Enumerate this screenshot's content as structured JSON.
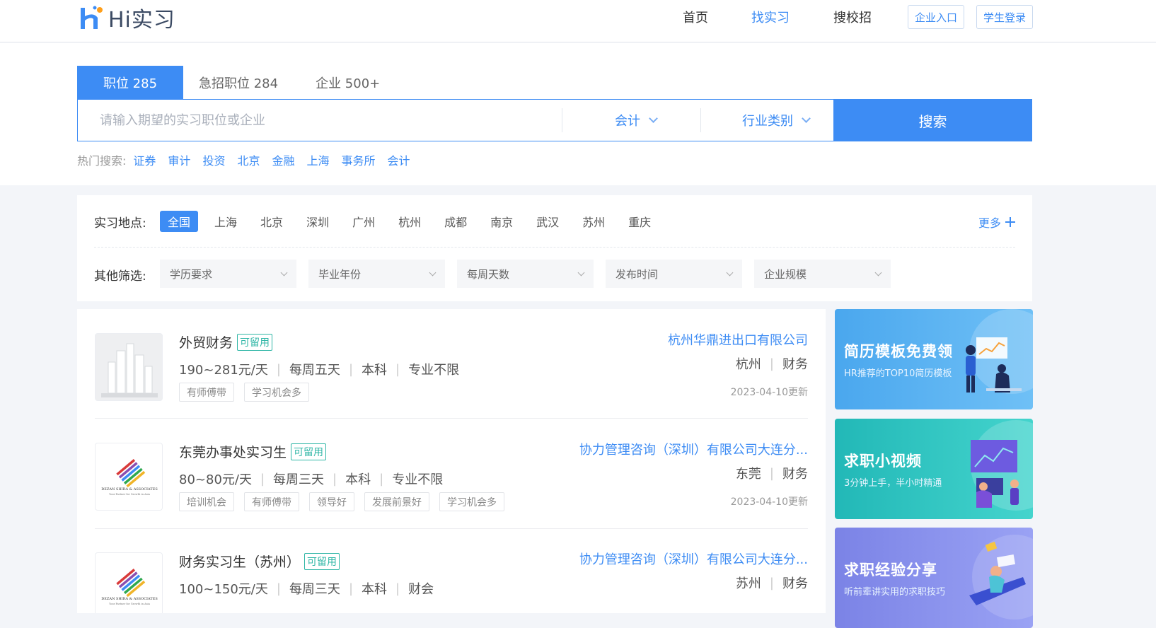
{
  "header": {
    "logo_text": "Hi实习",
    "nav": {
      "home": "首页",
      "find": "找实习",
      "campus": "搜校招"
    },
    "enterprise_btn": "企业入口",
    "student_btn": "学生登录"
  },
  "search": {
    "tabs": [
      "职位 285",
      "急招职位 284",
      "企业 500+"
    ],
    "placeholder": "请输入期望的实习职位或企业",
    "category": "会计",
    "industry": "行业类别",
    "button": "搜索",
    "hot_label": "热门搜索:",
    "hot": [
      "证券",
      "审计",
      "投资",
      "北京",
      "金融",
      "上海",
      "事务所",
      "会计"
    ]
  },
  "filters": {
    "location_label": "实习地点:",
    "locations": [
      "全国",
      "上海",
      "北京",
      "深圳",
      "广州",
      "杭州",
      "成都",
      "南京",
      "武汉",
      "苏州",
      "重庆"
    ],
    "more": "更多",
    "other_label": "其他筛选:",
    "dropdowns": [
      "学历要求",
      "毕业年份",
      "每周天数",
      "发布时间",
      "企业规模"
    ]
  },
  "jobs": [
    {
      "title": "外贸财务",
      "badge": "可留用",
      "salary": "190~281元/天",
      "days": "每周五天",
      "degree": "本科",
      "major": "专业不限",
      "tags": [
        "有师傅带",
        "学习机会多"
      ],
      "company": "杭州华鼎进出口有限公司",
      "city": "杭州",
      "industry": "财务",
      "updated": "2023-04-10更新"
    },
    {
      "title": "东莞办事处实习生",
      "badge": "可留用",
      "salary": "80~80元/天",
      "days": "每周三天",
      "degree": "本科",
      "major": "专业不限",
      "tags": [
        "培训机会",
        "有师傅带",
        "领导好",
        "发展前景好",
        "学习机会多"
      ],
      "company": "协力管理咨询（深圳）有限公司大连分...",
      "city": "东莞",
      "industry": "财务",
      "updated": "2023-04-10更新",
      "logo_lines": [
        "DEZAN SHIRA & ASSOCIATES",
        "Your Partner for Growth in Asia"
      ]
    },
    {
      "title": "财务实习生（苏州）",
      "badge": "可留用",
      "salary": "100~150元/天",
      "days": "每周三天",
      "degree": "本科",
      "major": "财会",
      "company": "协力管理咨询（深圳）有限公司大连分...",
      "city": "苏州",
      "industry": "财务",
      "logo_lines": [
        "DEZAN SHIRA & ASSOCIATES",
        "Your Partner for Growth in Asia"
      ]
    }
  ],
  "banners": [
    {
      "title": "简历模板免费领",
      "subtitle": "HR推荐的TOP10简历模板"
    },
    {
      "title": "求职小视频",
      "subtitle": "3分钟上手，半小时精通"
    },
    {
      "title": "求职经验分享",
      "subtitle": "听前辈讲实用的求职技巧"
    }
  ],
  "colors": {
    "accent": "#3d8cf4",
    "badge": "#2fb6a6"
  }
}
